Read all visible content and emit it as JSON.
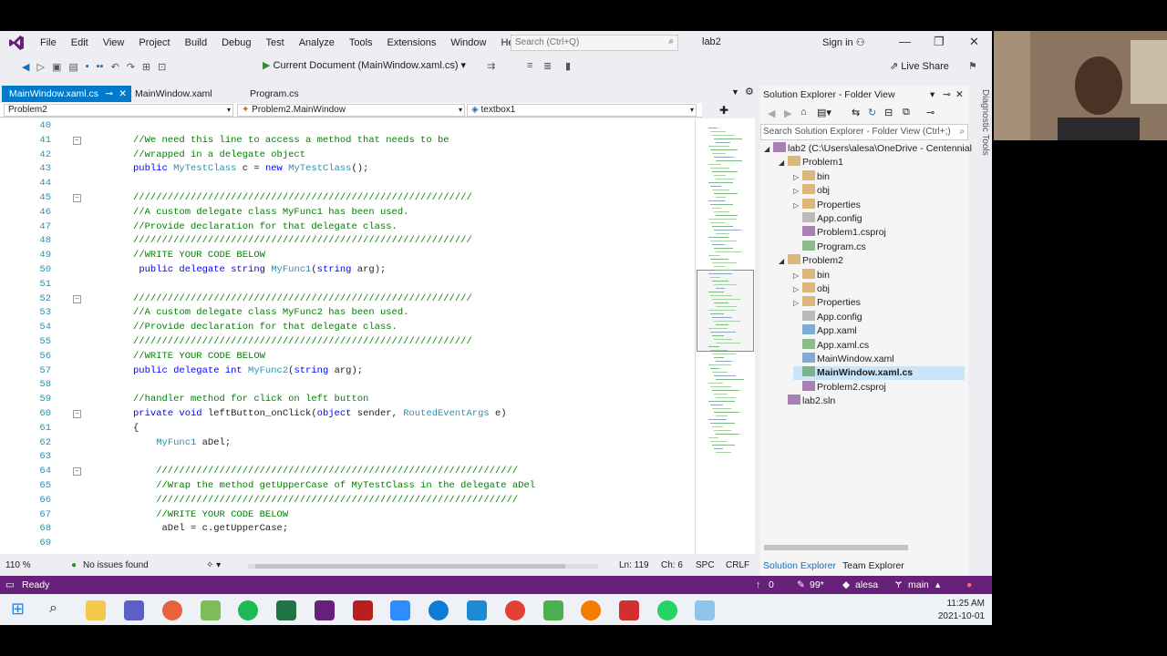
{
  "menubar": {
    "items": [
      "File",
      "Edit",
      "View",
      "Project",
      "Build",
      "Debug",
      "Test",
      "Analyze",
      "Tools",
      "Extensions",
      "Window",
      "Help"
    ],
    "search_placeholder": "Search (Ctrl+Q)",
    "solution_name": "lab2",
    "sign_in": "Sign in"
  },
  "toolbar": {
    "current_document": "Current Document (MainWindow.xaml.cs)",
    "live_share": "Live Share"
  },
  "tabs": [
    {
      "label": "MainWindow.xaml.cs",
      "active": true
    },
    {
      "label": "MainWindow.xaml",
      "active": false
    },
    {
      "label": "Program.cs",
      "active": false
    }
  ],
  "navbar": {
    "project": "Problem2",
    "class": "Problem2.MainWindow",
    "member": "textbox1"
  },
  "code_lines": [
    {
      "n": "40",
      "t": "",
      "c": "plain"
    },
    {
      "n": "41",
      "t": "//We need this line to access a method that needs to be",
      "c": "com",
      "fold": true
    },
    {
      "n": "42",
      "t": "//wrapped in a delegate object",
      "c": "com"
    },
    {
      "n": "43",
      "t": "",
      "c": "plain",
      "parts": [
        [
          "kw",
          "public "
        ],
        [
          "type",
          "MyTestClass"
        ],
        [
          "plain",
          " c = "
        ],
        [
          "kw",
          "new "
        ],
        [
          "type",
          "MyTestClass"
        ],
        [
          "plain",
          "();"
        ]
      ]
    },
    {
      "n": "44",
      "t": "",
      "c": "plain"
    },
    {
      "n": "45",
      "t": "///////////////////////////////////////////////////////////",
      "c": "com",
      "fold": true
    },
    {
      "n": "46",
      "t": "//A custom delegate class MyFunc1 has been used.",
      "c": "com"
    },
    {
      "n": "47",
      "t": "//Provide declaration for that delegate class.",
      "c": "com"
    },
    {
      "n": "48",
      "t": "///////////////////////////////////////////////////////////",
      "c": "com"
    },
    {
      "n": "49",
      "t": "//WRITE YOUR CODE BELOW",
      "c": "com"
    },
    {
      "n": "50",
      "t": "",
      "c": "plain",
      "parts": [
        [
          "plain",
          " "
        ],
        [
          "kw",
          "public delegate string "
        ],
        [
          "type",
          "MyFunc1"
        ],
        [
          "plain",
          "("
        ],
        [
          "kw",
          "string"
        ],
        [
          "plain",
          " arg);"
        ]
      ]
    },
    {
      "n": "51",
      "t": "",
      "c": "plain"
    },
    {
      "n": "52",
      "t": "///////////////////////////////////////////////////////////",
      "c": "com",
      "fold": true
    },
    {
      "n": "53",
      "t": "//A custom delegate class MyFunc2 has been used.",
      "c": "com"
    },
    {
      "n": "54",
      "t": "//Provide declaration for that delegate class.",
      "c": "com"
    },
    {
      "n": "55",
      "t": "///////////////////////////////////////////////////////////",
      "c": "com"
    },
    {
      "n": "56",
      "t": "//WRITE YOUR CODE BELOW",
      "c": "com"
    },
    {
      "n": "57",
      "t": "",
      "c": "plain",
      "parts": [
        [
          "kw",
          "public delegate int "
        ],
        [
          "type",
          "MyFunc2"
        ],
        [
          "plain",
          "("
        ],
        [
          "kw",
          "string"
        ],
        [
          "plain",
          " arg);"
        ]
      ]
    },
    {
      "n": "58",
      "t": "",
      "c": "plain"
    },
    {
      "n": "59",
      "t": "//handler method for click on left button",
      "c": "com"
    },
    {
      "n": "60",
      "t": "",
      "c": "plain",
      "fold": true,
      "parts": [
        [
          "kw",
          "private void "
        ],
        [
          "plain",
          "leftButton_onClick("
        ],
        [
          "kw",
          "object"
        ],
        [
          "plain",
          " sender, "
        ],
        [
          "type",
          "RoutedEventArgs"
        ],
        [
          "plain",
          " e)"
        ]
      ]
    },
    {
      "n": "61",
      "t": "{",
      "c": "plain"
    },
    {
      "n": "62",
      "t": "",
      "c": "plain",
      "parts": [
        [
          "plain",
          "    "
        ],
        [
          "type",
          "MyFunc1"
        ],
        [
          "plain",
          " aDel;"
        ]
      ]
    },
    {
      "n": "63",
      "t": "",
      "c": "plain"
    },
    {
      "n": "64",
      "t": "    ///////////////////////////////////////////////////////////////",
      "c": "com",
      "fold": true
    },
    {
      "n": "65",
      "t": "    //Wrap the method getUpperCase of MyTestClass in the delegate aDel",
      "c": "com"
    },
    {
      "n": "66",
      "t": "    ///////////////////////////////////////////////////////////////",
      "c": "com"
    },
    {
      "n": "67",
      "t": "    //WRITE YOUR CODE BELOW",
      "c": "com"
    },
    {
      "n": "68",
      "t": "     aDel = c.getUpperCase;",
      "c": "plain"
    },
    {
      "n": "69",
      "t": "",
      "c": "plain"
    }
  ],
  "editor_status": {
    "zoom": "110 %",
    "issues": "No issues found",
    "line": "Ln: 119",
    "col": "Ch: 6",
    "spc": "SPC",
    "eol": "CRLF"
  },
  "solution_explorer": {
    "title": "Solution Explorer - Folder View",
    "search_placeholder": "Search Solution Explorer - Folder View (Ctrl+;)",
    "items": [
      {
        "label": "lab2 (C:\\Users\\alesa\\OneDrive - Centennial",
        "depth": 0,
        "kind": "solution",
        "arrow": "expanded"
      },
      {
        "label": "Problem1",
        "depth": 1,
        "kind": "folder",
        "arrow": "expanded"
      },
      {
        "label": "bin",
        "depth": 2,
        "kind": "folder",
        "arrow": "collapsed"
      },
      {
        "label": "obj",
        "depth": 2,
        "kind": "folder",
        "arrow": "collapsed"
      },
      {
        "label": "Properties",
        "depth": 2,
        "kind": "folder",
        "arrow": "collapsed"
      },
      {
        "label": "App.config",
        "depth": 2,
        "kind": "config",
        "arrow": "none"
      },
      {
        "label": "Problem1.csproj",
        "depth": 2,
        "kind": "csproj",
        "arrow": "none"
      },
      {
        "label": "Program.cs",
        "depth": 2,
        "kind": "cs",
        "arrow": "none"
      },
      {
        "label": "Problem2",
        "depth": 1,
        "kind": "folder",
        "arrow": "expanded"
      },
      {
        "label": "bin",
        "depth": 2,
        "kind": "folder",
        "arrow": "collapsed"
      },
      {
        "label": "obj",
        "depth": 2,
        "kind": "folder",
        "arrow": "collapsed"
      },
      {
        "label": "Properties",
        "depth": 2,
        "kind": "folder",
        "arrow": "collapsed"
      },
      {
        "label": "App.config",
        "depth": 2,
        "kind": "config",
        "arrow": "none"
      },
      {
        "label": "App.xaml",
        "depth": 2,
        "kind": "xaml",
        "arrow": "none"
      },
      {
        "label": "App.xaml.cs",
        "depth": 2,
        "kind": "cs",
        "arrow": "none"
      },
      {
        "label": "MainWindow.xaml",
        "depth": 2,
        "kind": "xaml",
        "arrow": "none"
      },
      {
        "label": "MainWindow.xaml.cs",
        "depth": 2,
        "kind": "cs",
        "arrow": "none",
        "selected": true
      },
      {
        "label": "Problem2.csproj",
        "depth": 2,
        "kind": "csproj",
        "arrow": "none"
      },
      {
        "label": "lab2.sln",
        "depth": 1,
        "kind": "sln",
        "arrow": "none"
      }
    ],
    "bottom_tabs": [
      "Solution Explorer",
      "Team Explorer"
    ],
    "diagnostic_tools": "Diagnostic Tools"
  },
  "statusbar": {
    "ready": "Ready",
    "errors": "0",
    "warnings": "99*",
    "user": "alesa",
    "branch": "main",
    "accent": "#68217a"
  },
  "taskbar": {
    "time": "11:25 AM",
    "date": "2021-10-01"
  }
}
